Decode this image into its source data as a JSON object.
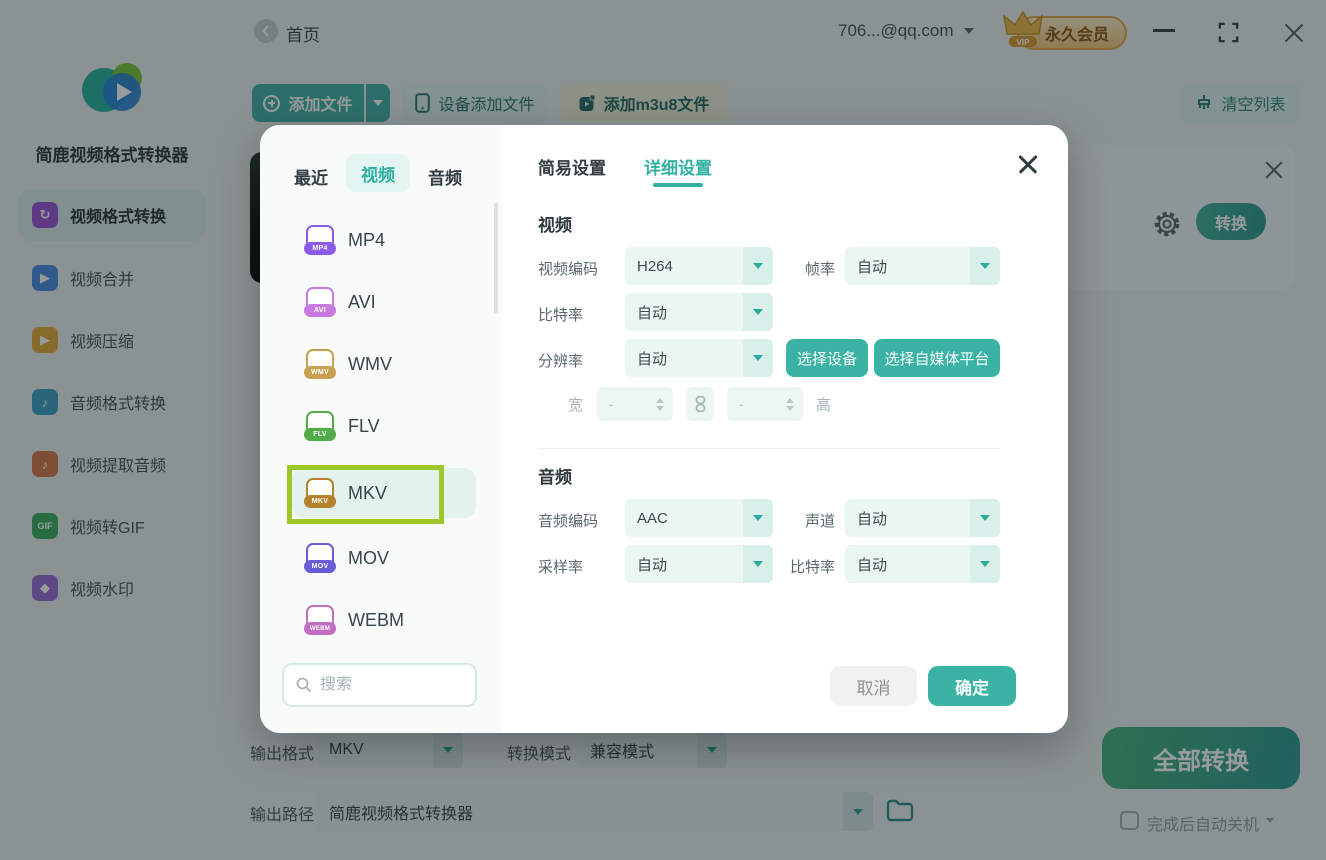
{
  "titlebar": {
    "home": "首页",
    "account": "706...@qq.com",
    "vip_badge": "永久会员",
    "vip_crown_text": "VIP"
  },
  "sidebar": {
    "app_title": "简鹿视频格式转换器",
    "items": [
      {
        "label": "视频格式转换",
        "glyph": "↻",
        "color": "#9b59d6",
        "active": true
      },
      {
        "label": "视频合并",
        "glyph": "▶",
        "color": "#4a8fe2"
      },
      {
        "label": "视频压缩",
        "glyph": "▶",
        "color": "#dfae3e"
      },
      {
        "label": "音频格式转换",
        "glyph": "♪",
        "color": "#41a3c4"
      },
      {
        "label": "视频提取音频",
        "glyph": "♪",
        "color": "#d07a4a"
      },
      {
        "label": "视频转GIF",
        "glyph": "GIF",
        "color": "#3fae62"
      },
      {
        "label": "视频水印",
        "glyph": "◆",
        "color": "#9a6fd6"
      }
    ]
  },
  "toolbar": {
    "add_file": "添加文件",
    "device_add": "设备添加文件",
    "add_m3u8": "添加m3u8文件",
    "clear_list": "清空列表"
  },
  "file_row": {
    "convert": "转换"
  },
  "output": {
    "format_label": "输出格式",
    "format_value": "MKV",
    "mode_label": "转换模式",
    "mode_value": "兼容模式",
    "path_label": "输出路径",
    "path_value": "简鹿视频格式转换器",
    "convert_all": "全部转换",
    "auto_shutdown": "完成后自动关机"
  },
  "modal": {
    "picker": {
      "tab_recent": "最近",
      "tab_video": "视频",
      "tab_audio": "音频",
      "selected": "MKV",
      "search_placeholder": "搜索",
      "formats": [
        {
          "name": "MP4",
          "color": "#8a5ce8"
        },
        {
          "name": "AVI",
          "color": "#c97ae0"
        },
        {
          "name": "WMV",
          "color": "#c9a050"
        },
        {
          "name": "FLV",
          "color": "#54ab4a"
        },
        {
          "name": "MKV",
          "color": "#b5812f"
        },
        {
          "name": "MOV",
          "color": "#6a5bd8"
        },
        {
          "name": "WEBM",
          "color": "#c06ec0"
        }
      ]
    },
    "settings": {
      "tab_simple": "简易设置",
      "tab_detail": "详细设置",
      "video_section": "视频",
      "video_codec_label": "视频编码",
      "video_codec_value": "H264",
      "fps_label": "帧率",
      "fps_value": "自动",
      "bitrate_label": "比特率",
      "bitrate_value": "自动",
      "resolution_label": "分辨率",
      "resolution_value": "自动",
      "select_device": "选择设备",
      "select_platform": "选择自媒体平台",
      "width_label": "宽",
      "height_label": "高",
      "size_placeholder": "-",
      "audio_section": "音频",
      "audio_codec_label": "音频编码",
      "audio_codec_value": "AAC",
      "channel_label": "声道",
      "channel_value": "自动",
      "sample_label": "采样率",
      "sample_value": "自动",
      "audio_bitrate_label": "比特率",
      "audio_bitrate_value": "自动",
      "cancel": "取消",
      "ok": "确定"
    }
  },
  "colors": {
    "primary_teal": "#3bb3a4",
    "light_teal_button": "#ddf0ec",
    "annotation_green": "#9dc829",
    "vip_gold_border": "#dfab52",
    "convert_all_gradient_start": "#4cb47e",
    "convert_all_gradient_end": "#2e9c95",
    "modal_selected_row": "#e4f2ee",
    "overlay": "rgba(10,16,18,0.42)"
  }
}
